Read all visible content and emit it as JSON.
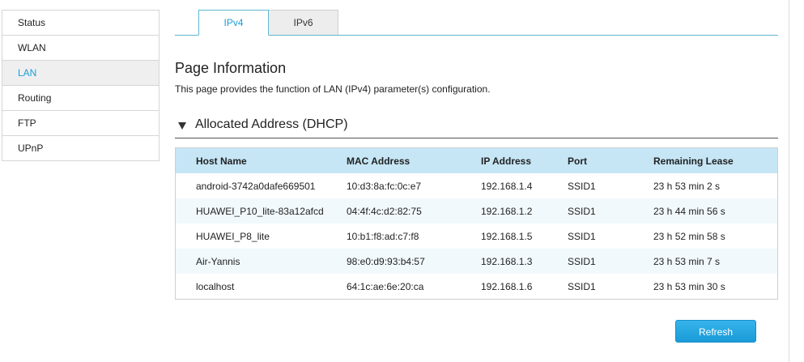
{
  "sidebar": {
    "items": [
      {
        "label": "Status"
      },
      {
        "label": "WLAN"
      },
      {
        "label": "LAN"
      },
      {
        "label": "Routing"
      },
      {
        "label": "FTP"
      },
      {
        "label": "UPnP"
      }
    ],
    "active_index": 2
  },
  "tabs": [
    {
      "label": "IPv4"
    },
    {
      "label": "IPv6"
    }
  ],
  "page_info": {
    "title": "Page Information",
    "description": "This page provides the function of LAN (IPv4) parameter(s) configuration."
  },
  "section": {
    "title": "Allocated Address (DHCP)"
  },
  "table": {
    "headers": [
      "Host Name",
      "MAC Address",
      "IP Address",
      "Port",
      "Remaining Lease"
    ],
    "rows": [
      [
        "android-3742a0dafe669501",
        "10:d3:8a:fc:0c:e7",
        "192.168.1.4",
        "SSID1",
        "23 h 53 min 2 s"
      ],
      [
        "HUAWEI_P10_lite-83a12afcd",
        "04:4f:4c:d2:82:75",
        "192.168.1.2",
        "SSID1",
        "23 h 44 min 56 s"
      ],
      [
        "HUAWEI_P8_lite",
        "10:b1:f8:ad:c7:f8",
        "192.168.1.5",
        "SSID1",
        "23 h 52 min 58 s"
      ],
      [
        "Air-Yannis",
        "98:e0:d9:93:b4:57",
        "192.168.1.3",
        "SSID1",
        "23 h 53 min 7 s"
      ],
      [
        "localhost",
        "64:1c:ae:6e:20:ca",
        "192.168.1.6",
        "SSID1",
        "23 h 53 min 30 s"
      ]
    ]
  },
  "buttons": {
    "refresh_label": "Refresh"
  },
  "colors": {
    "accent": "#1a9fd9",
    "table_header_bg": "#c6e6f6"
  }
}
